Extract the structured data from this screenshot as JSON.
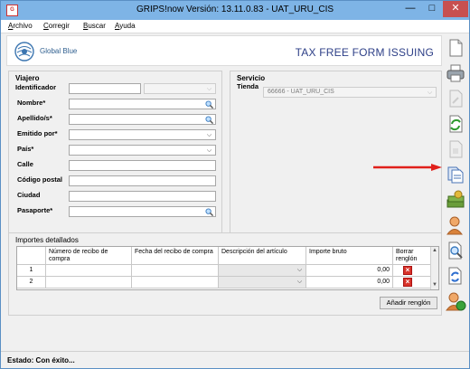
{
  "window": {
    "title": "GRIPS!now Versión: 13.11.0.83 - UAT_URU_CIS",
    "app_icon_text": "G",
    "minimize_label": "—",
    "maximize_label": "□",
    "close_label": "✕"
  },
  "menu": {
    "items": [
      "Archivo",
      "Corregir",
      "Buscar",
      "Ayuda"
    ]
  },
  "header": {
    "logo_text": "Global Blue",
    "title": "TAX FREE FORM ISSUING"
  },
  "traveler": {
    "panel_title": "Viajero",
    "fields": {
      "identificador": {
        "label": "Identificador",
        "value": "",
        "type_value": ""
      },
      "nombre": {
        "label": "Nombre*",
        "value": ""
      },
      "apellido": {
        "label": "Apellido/s*",
        "value": ""
      },
      "emitido_por": {
        "label": "Emitido por*",
        "value": ""
      },
      "pais": {
        "label": "País*",
        "value": ""
      },
      "calle": {
        "label": "Calle",
        "value": ""
      },
      "codigo_postal": {
        "label": "Código postal",
        "value": ""
      },
      "ciudad": {
        "label": "Ciudad",
        "value": ""
      },
      "pasaporte": {
        "label": "Pasaporte*",
        "value": ""
      }
    }
  },
  "service": {
    "panel_title": "Servicio",
    "tienda_label": "Tienda",
    "tienda_value": "66666 - UAT_URU_CIS"
  },
  "amounts": {
    "panel_title": "Importes detallados",
    "columns": [
      "",
      "Número de recibo de compra",
      "Fecha del recibo de compra",
      "Descripción del artículo",
      "Importe bruto",
      "Borrar renglón"
    ],
    "rows": [
      {
        "num": "1",
        "receipt": "",
        "date": "",
        "description": "",
        "amount": "0,00"
      },
      {
        "num": "2",
        "receipt": "",
        "date": "",
        "description": "",
        "amount": "0,00"
      }
    ],
    "add_row_label": "Añadir renglón"
  },
  "status": {
    "text": "Estado:  Con éxito..."
  },
  "toolbar": {
    "icons": [
      "new-document-icon",
      "print-icon",
      "document-disabled-icon",
      "refresh-document-icon",
      "document-disabled-icon-2",
      "copy-document-icon",
      "money-stack-icon",
      "customer-icon",
      "search-document-icon",
      "sync-document-icon",
      "user-refresh-icon"
    ]
  },
  "colors": {
    "titlebar": "#7eb4e6",
    "header_title": "#2d3f87",
    "close_button": "#c75050",
    "arrow": "#e0201b"
  }
}
